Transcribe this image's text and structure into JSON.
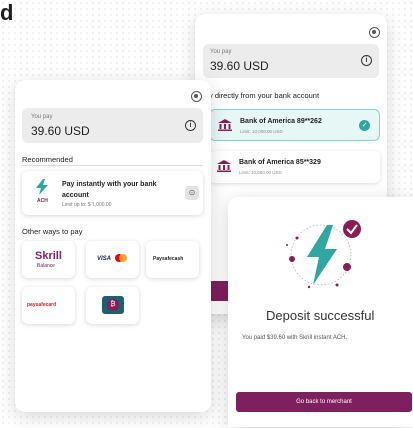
{
  "corner_fragment": "d",
  "back_card": {
    "pay_label": "You pay",
    "pay_amount": "39.60 USD",
    "section_label": "y directly from your bank account",
    "banks": [
      {
        "name": "Bank of America 89**262",
        "limit": "Limit: 10,000.00 USD",
        "selected": true
      },
      {
        "name": "Bank of America 85**329",
        "limit": "Limit: 10,000.00 USD",
        "selected": false
      }
    ]
  },
  "mid_card": {
    "pay_label": "You pay",
    "pay_amount": "39.60 USD",
    "recommended_label": "Recommended",
    "ach": {
      "logo_text": "ACH",
      "title": "Pay instantly with your bank account",
      "limit": "Limit up to: $ 1,000.00"
    },
    "other_label": "Other ways to pay",
    "methods": [
      {
        "name": "Skrill",
        "sub": "Balance"
      },
      {
        "name": "VISA"
      },
      {
        "name": "Paysafecash"
      },
      {
        "name": "paysafecard"
      },
      {
        "name": "Crypto wallet"
      }
    ]
  },
  "success_card": {
    "title": "Deposit successful",
    "message": "You paid $39.60 with Skrill instant ACH.",
    "button_label": "Go back to merchant"
  },
  "colors": {
    "brand": "#7e1f5e",
    "teal": "#2fa6a0",
    "bank_icon": "#8a1d53"
  }
}
